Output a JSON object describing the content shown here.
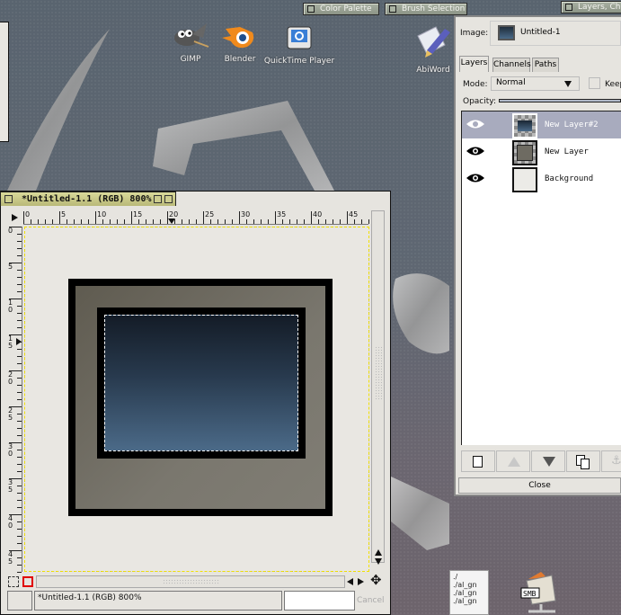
{
  "taskbar": {
    "buttons": [
      {
        "label": "Color Palette"
      },
      {
        "label": "Brush Selection"
      },
      {
        "label": "Layers, Ch"
      }
    ]
  },
  "desktop": {
    "icons": [
      {
        "label": "GIMP",
        "icon": "gimp-icon"
      },
      {
        "label": "Blender",
        "icon": "blender-icon"
      },
      {
        "label": "QuickTime Player",
        "icon": "quicktime-icon"
      },
      {
        "label": "AbiWord",
        "icon": "abiword-icon"
      },
      {
        "label": "SMB",
        "icon": "smb-share-icon"
      }
    ],
    "text_file_lines": [
      "./",
      "./al_gn",
      "./al_gn",
      "./al_gn"
    ]
  },
  "image_window": {
    "title": "*Untitled-1.1 (RGB) 800%",
    "zoom": "800%",
    "ruler_h": [
      "0",
      "5",
      "10",
      "15",
      "20",
      "25",
      "30",
      "35",
      "40",
      "45"
    ],
    "ruler_v": [
      "0",
      "5",
      "10",
      "15",
      "20",
      "25",
      "30",
      "35",
      "40",
      "45"
    ],
    "status_text": "*Untitled-1.1 (RGB) 800%",
    "cancel_label": "Cancel",
    "colors": {
      "frame_outer": "#000000",
      "frame_fill": "#76726a",
      "gradient_top": "#151e2a",
      "gradient_bottom": "#4a6a88",
      "canvas_bg": "#e9e7e2"
    }
  },
  "layers_dialog": {
    "image_label": "Image:",
    "image_name": "Untitled-1",
    "tabs": [
      {
        "label": "Layers",
        "active": true
      },
      {
        "label": "Channels",
        "active": false
      },
      {
        "label": "Paths",
        "active": false
      }
    ],
    "mode_label": "Mode:",
    "mode_value": "Normal",
    "keep_label": "Keep",
    "opacity_label": "Opacity:",
    "layers": [
      {
        "name": "New Layer#2",
        "visible": true,
        "selected": true
      },
      {
        "name": "New Layer",
        "visible": true,
        "selected": false
      },
      {
        "name": "Background",
        "visible": true,
        "selected": false
      }
    ],
    "buttons": [
      {
        "name": "new-layer"
      },
      {
        "name": "raise-layer",
        "disabled": true
      },
      {
        "name": "lower-layer"
      },
      {
        "name": "duplicate-layer"
      },
      {
        "name": "anchor-layer",
        "disabled": true
      }
    ],
    "close_label": "Close"
  }
}
